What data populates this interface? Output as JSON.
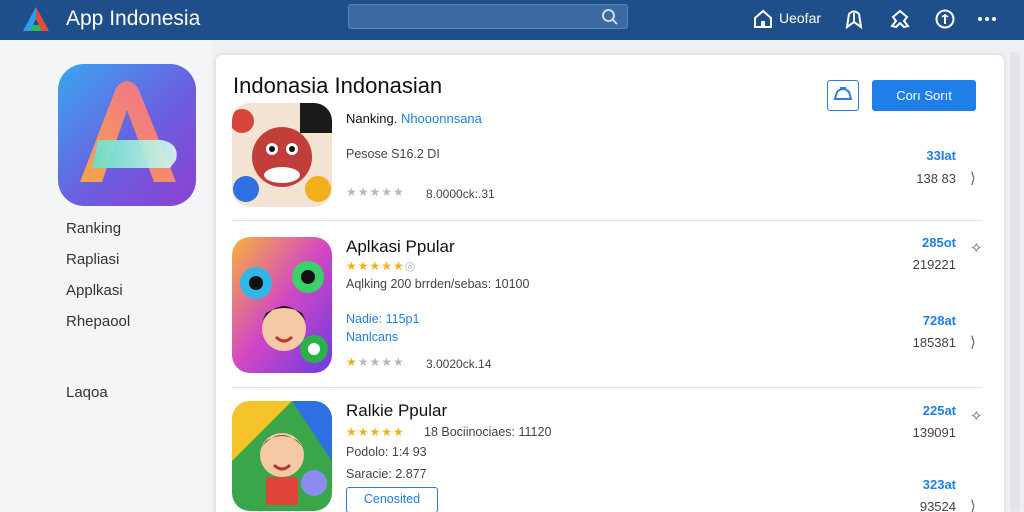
{
  "header": {
    "title": "App Indonesia",
    "search_placeholder": "",
    "home_label": "Ueofar",
    "icons": [
      "home-icon",
      "bookmark-icon",
      "tag-icon",
      "info-icon",
      "more-icon"
    ]
  },
  "sidebar": {
    "items": [
      {
        "label": "Ranking"
      },
      {
        "label": "Rapliasi"
      },
      {
        "label": "Applkasi"
      },
      {
        "label": "Rhepaool"
      },
      {
        "label": "Laqoa"
      }
    ]
  },
  "main": {
    "title": "Indonasia  Indonasian",
    "primary_button": "Corı Sorıt",
    "apps": [
      {
        "name_prefix": "Nanking.",
        "name_link": "Nhooonnsana",
        "meta1": "Pesose S16.2 DI",
        "rating_text": "8.0000ck:.31",
        "stars_gold": 1,
        "right_blue": "33Iat",
        "right_gray": "138 83",
        "right_icon": "⟩"
      },
      {
        "name": "Aplkasi Ppular",
        "meta1": "Aqlking 200 brrden/sebas: 10100",
        "meta2_link": "Nadie: 115p1",
        "meta3_link": "Nanlcans",
        "rating_text": "3.0020ck.14",
        "stars_gold": 5,
        "right_blue1": "285ot",
        "right_gray1": "219221",
        "right_blue2": "728at",
        "right_gray2": "185381",
        "right_icon1": "✧",
        "right_icon2": "⟩"
      },
      {
        "name": "Ralkie Ppular",
        "meta1": "18 Bociinociaes: 11120",
        "meta2": "Podolo: 1:4 93",
        "meta3": "Saracie: 2.877",
        "button": "Cenosited",
        "stars_gold": 5,
        "right_blue1": "225at",
        "right_gray1": "139091",
        "right_blue2": "323at",
        "right_gray2": "93524",
        "right_icon1": "✧",
        "right_icon2": "⟩"
      }
    ]
  },
  "colors": {
    "topbar": "#1f4f8a",
    "accent": "#1e7fe8",
    "star": "#f2b01e"
  }
}
